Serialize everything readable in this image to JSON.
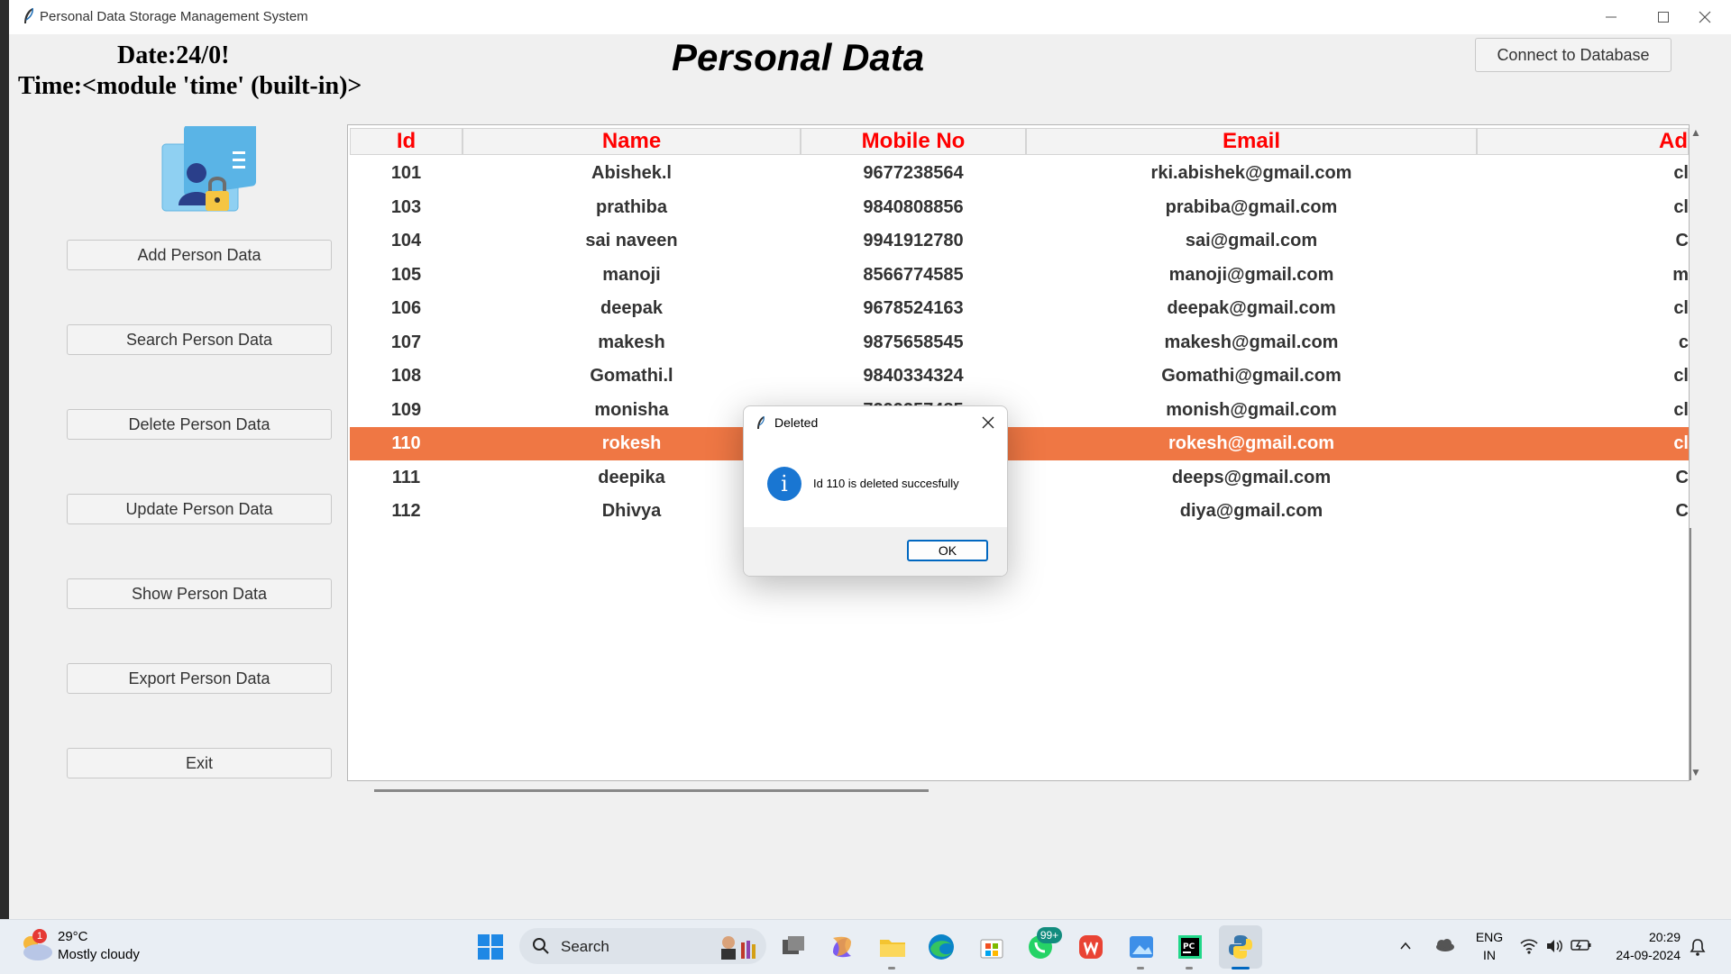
{
  "window": {
    "title": "Personal Data Storage Management System",
    "minimize": "—",
    "maximize": "☐",
    "close": "✕"
  },
  "header": {
    "date": "Date:24/0!",
    "time": "Time:<module 'time' (built-in)>",
    "title": "Personal Data",
    "connect_label": "Connect to Database"
  },
  "sidebar": {
    "buttons": [
      {
        "label": "Add Person Data"
      },
      {
        "label": "Search Person Data"
      },
      {
        "label": "Delete Person Data"
      },
      {
        "label": "Update Person Data"
      },
      {
        "label": "Show Person Data"
      },
      {
        "label": "Export Person Data"
      },
      {
        "label": "Exit"
      }
    ]
  },
  "table": {
    "columns": [
      "Id",
      "Name",
      "Mobile No",
      "Email",
      "Ad"
    ],
    "rows": [
      {
        "id": "101",
        "name": "Abishek.l",
        "mobile": "9677238564",
        "email": "rki.abishek@gmail.com",
        "address": "cl"
      },
      {
        "id": "103",
        "name": "prathiba",
        "mobile": "9840808856",
        "email": "prabiba@gmail.com",
        "address": "cl"
      },
      {
        "id": "104",
        "name": "sai naveen",
        "mobile": "9941912780",
        "email": "sai@gmail.com",
        "address": "C"
      },
      {
        "id": "105",
        "name": "manoji",
        "mobile": "8566774585",
        "email": "manoji@gmail.com",
        "address": "m"
      },
      {
        "id": "106",
        "name": "deepak",
        "mobile": "9678524163",
        "email": "deepak@gmail.com",
        "address": "cl"
      },
      {
        "id": "107",
        "name": "makesh",
        "mobile": "9875658545",
        "email": "makesh@gmail.com",
        "address": "c"
      },
      {
        "id": "108",
        "name": "Gomathi.l",
        "mobile": "9840334324",
        "email": "Gomathi@gmail.com",
        "address": "cl"
      },
      {
        "id": "109",
        "name": "monisha",
        "mobile": "7299257485",
        "email": "monish@gmail.com",
        "address": "cl"
      },
      {
        "id": "110",
        "name": "rokesh",
        "mobile": "",
        "email": "rokesh@gmail.com",
        "address": "cl"
      },
      {
        "id": "111",
        "name": "deepika",
        "mobile": "",
        "email": "deeps@gmail.com",
        "address": "C"
      },
      {
        "id": "112",
        "name": "Dhivya",
        "mobile": "",
        "email": "diya@gmail.com",
        "address": "C"
      }
    ],
    "selected_index": 8
  },
  "dialog": {
    "title": "Deleted",
    "message": "Id 110 is deleted succesfully",
    "ok_label": "OK",
    "info_glyph": "i"
  },
  "taskbar": {
    "weather_temp": "29°C",
    "weather_desc": "Mostly cloudy",
    "weather_badge": "1",
    "search_label": "Search",
    "whatsapp_badge": "99+",
    "lang_line1": "ENG",
    "lang_line2": "IN",
    "clock_time": "20:29",
    "clock_date": "24-09-2024"
  },
  "colors": {
    "header_text": "#ff0000",
    "selected_row": "#ef7744",
    "dialog_accent": "#0067c0"
  }
}
